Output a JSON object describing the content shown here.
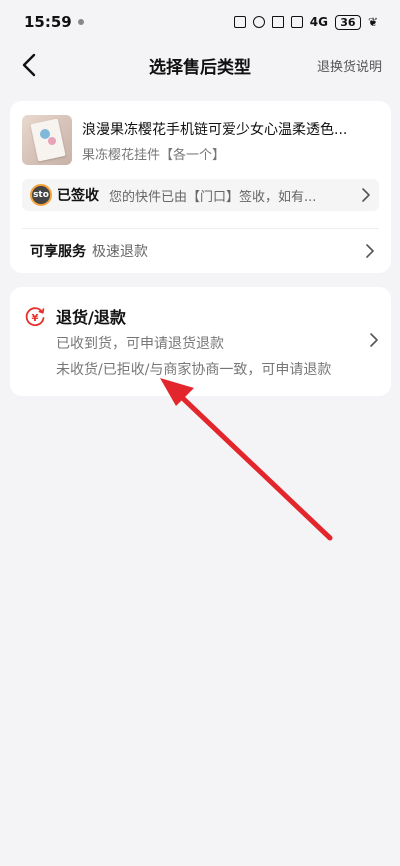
{
  "status_bar": {
    "time": "15:59",
    "network": "4G",
    "battery": "36"
  },
  "nav": {
    "title": "选择售后类型",
    "right_link": "退换货说明"
  },
  "product": {
    "title": "浪漫果冻樱花手机链可爱少女心温柔透色...",
    "spec": "果冻樱花挂件【各一个】"
  },
  "logistics": {
    "carrier_logo": "sto",
    "status": "已签收",
    "detail": "您的快件已由【门口】签收，如有..."
  },
  "service": {
    "label": "可享服务",
    "value": "极速退款"
  },
  "refund_option": {
    "icon": "yen-refund-icon",
    "title": "退货/退款",
    "desc1": "已收到货，可申请退货退款",
    "desc2": "未收货/已拒收/与商家协商一致，可申请退款"
  },
  "colors": {
    "accent": "#e8302a",
    "background": "#f4f4f6"
  }
}
